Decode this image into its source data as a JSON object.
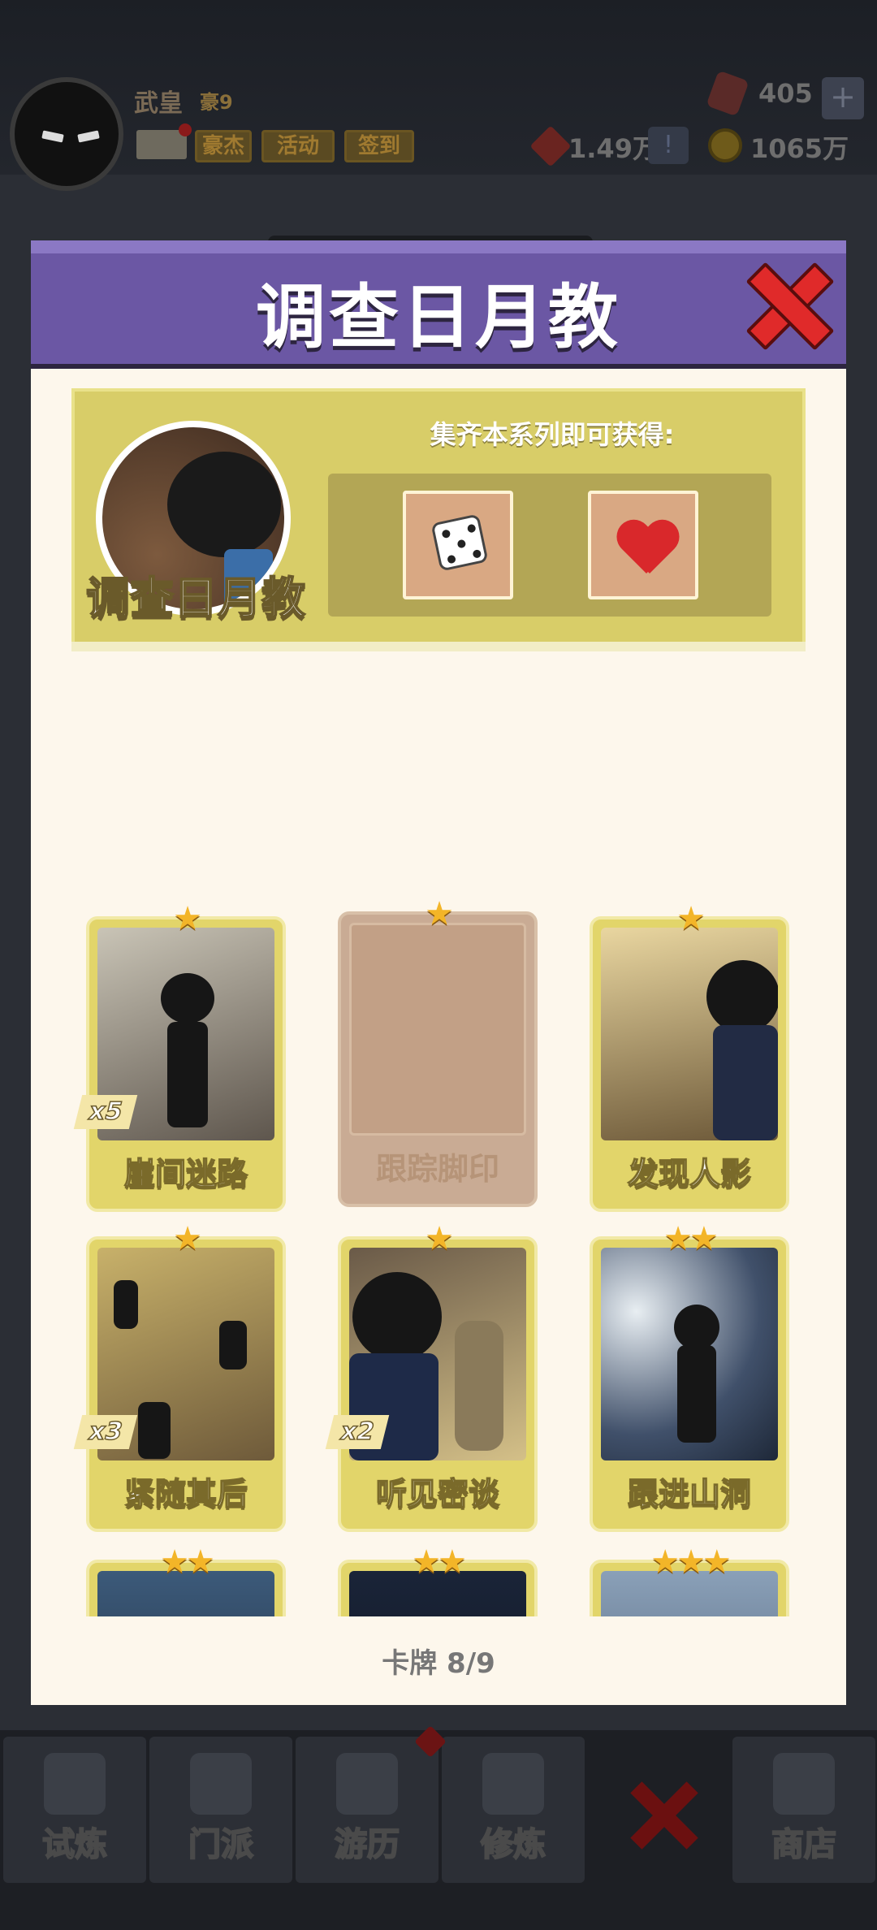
{
  "player": {
    "name": "武皇",
    "level": "豪9"
  },
  "top_buttons": [
    "豪杰",
    "活动",
    "签到"
  ],
  "resources": {
    "gems": "405",
    "tokens": "1.49万",
    "coins": "1065万"
  },
  "dialog": {
    "title": "调查日月教",
    "series_name": "调查日月教",
    "reward_label": "集齐本系列即可获得:",
    "reward_items": [
      "dice-icon",
      "heart-icon"
    ],
    "footer": "卡牌  8/9"
  },
  "cards": [
    {
      "name": "崖间迷路",
      "stars": "★",
      "count": "x5",
      "collected": true
    },
    {
      "name": "跟踪脚印",
      "stars": "★",
      "count": "",
      "collected": false
    },
    {
      "name": "发现人影",
      "stars": "★",
      "count": "",
      "collected": true
    },
    {
      "name": "紧随其后",
      "stars": "★",
      "count": "x3",
      "collected": true
    },
    {
      "name": "听见密谈",
      "stars": "★",
      "count": "x2",
      "collected": true
    },
    {
      "name": "跟进山洞",
      "stars": "★★",
      "count": "",
      "collected": true
    },
    {
      "name": "",
      "stars": "★★",
      "count": "",
      "collected": true
    },
    {
      "name": "",
      "stars": "★★",
      "count": "",
      "collected": true
    },
    {
      "name": "",
      "stars": "★★★",
      "count": "",
      "collected": true
    }
  ],
  "bottom_nav": [
    "试炼",
    "门派",
    "游历",
    "修炼",
    "",
    "商店"
  ],
  "colors": {
    "header": "#6b57a4",
    "banner": "#d8cd68",
    "panel": "#fdf7ec",
    "close": "#e02a2a",
    "star": "#f3b528"
  }
}
